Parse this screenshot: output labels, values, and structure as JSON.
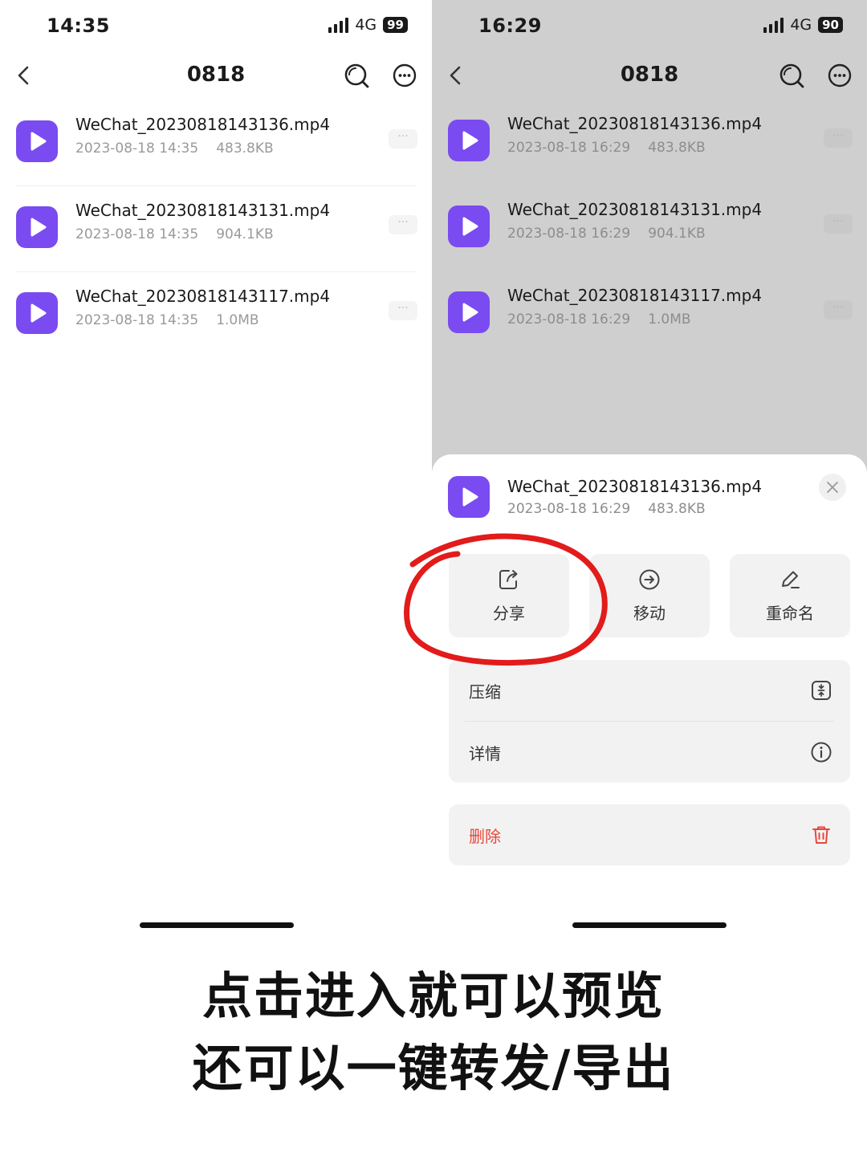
{
  "left_screen": {
    "status": {
      "time": "14:35",
      "network": "4G",
      "battery": "99"
    },
    "nav": {
      "title": "0818"
    },
    "files": [
      {
        "name": "WeChat_20230818143136.mp4",
        "date": "2023-08-18 14:35",
        "size": "483.8KB"
      },
      {
        "name": "WeChat_20230818143131.mp4",
        "date": "2023-08-18 14:35",
        "size": "904.1KB"
      },
      {
        "name": "WeChat_20230818143117.mp4",
        "date": "2023-08-18 14:35",
        "size": "1.0MB"
      }
    ]
  },
  "right_screen": {
    "status": {
      "time": "16:29",
      "network": "4G",
      "battery": "90"
    },
    "nav": {
      "title": "0818"
    },
    "files": [
      {
        "name": "WeChat_20230818143136.mp4",
        "date": "2023-08-18 16:29",
        "size": "483.8KB"
      },
      {
        "name": "WeChat_20230818143131.mp4",
        "date": "2023-08-18 16:29",
        "size": "904.1KB"
      },
      {
        "name": "WeChat_20230818143117.mp4",
        "date": "2023-08-18 16:29",
        "size": "1.0MB"
      }
    ],
    "sheet": {
      "file": {
        "name": "WeChat_20230818143136.mp4",
        "date": "2023-08-18 16:29",
        "size": "483.8KB"
      },
      "actions": {
        "share": "分享",
        "move": "移动",
        "rename": "重命名"
      },
      "menu": {
        "compress": "压缩",
        "details": "详情",
        "delete": "删除"
      }
    }
  },
  "caption": {
    "line1": "点击进入就可以预览",
    "line2": "还可以一键转发/导出"
  },
  "colors": {
    "video_icon": "#7a4bf0",
    "delete": "#e8473b",
    "annotation": "#e21b1b",
    "dim_overlay": "#cfcfcf"
  }
}
